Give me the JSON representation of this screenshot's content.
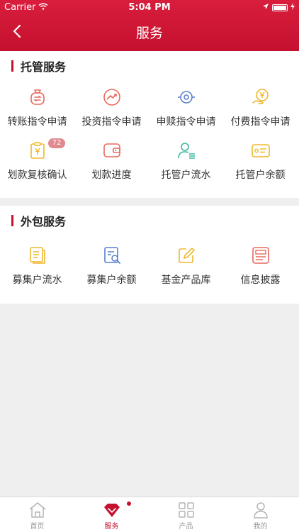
{
  "status": {
    "carrier": "Carrier",
    "time": "5:04 PM"
  },
  "nav": {
    "title": "服务"
  },
  "custody": {
    "title": "托管服务",
    "items": [
      {
        "label": "转账指令申请",
        "icon": "transfer-icon"
      },
      {
        "label": "投资指令申请",
        "icon": "invest-trend-icon"
      },
      {
        "label": "申赎指令申请",
        "icon": "redemption-icon"
      },
      {
        "label": "付费指令申请",
        "icon": "payment-icon"
      },
      {
        "label": "划款复核确认",
        "icon": "fund-review-icon",
        "badge": "72"
      },
      {
        "label": "划款进度",
        "icon": "wallet-icon"
      },
      {
        "label": "托管户流水",
        "icon": "account-flow-icon"
      },
      {
        "label": "托管户余额",
        "icon": "balance-card-icon"
      }
    ]
  },
  "outsourcing": {
    "title": "外包服务",
    "items": [
      {
        "label": "募集户流水",
        "icon": "collection-flow-icon"
      },
      {
        "label": "募集户余额",
        "icon": "collection-balance-icon"
      },
      {
        "label": "基金产品库",
        "icon": "fund-library-icon"
      },
      {
        "label": "信息披露",
        "icon": "disclosure-icon"
      }
    ]
  },
  "tabs": [
    {
      "label": "首页",
      "icon": "home-icon"
    },
    {
      "label": "服务",
      "icon": "service-diamond-icon",
      "active": true
    },
    {
      "label": "产品",
      "icon": "grid-icon"
    },
    {
      "label": "我的",
      "icon": "profile-icon"
    }
  ],
  "colors": {
    "brand": "#c5102f",
    "red_icon": "#e86a5e",
    "blue_icon": "#5a7fd0",
    "yellow_icon": "#f0b72f",
    "teal_icon": "#3cb7a0"
  }
}
